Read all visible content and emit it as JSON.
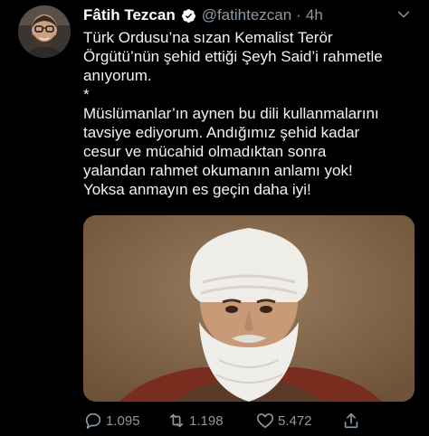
{
  "author": {
    "display_name": "Fâtih Tezcan",
    "handle": "@fatihtezcan",
    "separator": "·",
    "time": "4h",
    "avatar_icon": "avatar-photo"
  },
  "tweet": {
    "lines": [
      "Türk Ordusu’na sızan Kemalist Terör",
      "Örgütü’nün şehid ettiği Şeyh Said’i rahmetle",
      "anıyorum.",
      "*",
      "Müslümanlar’ın aynen bu dili kullanmalarını",
      "tavsiye ediyorum. Andığımız şehid kadar",
      "cesur ve mücahid olmadıktan sonra",
      "yalandan rahmet okumanın anlamı yok!",
      "Yoksa anmayın es geçin daha iyi!"
    ]
  },
  "media": {
    "alt_icon": "portrait-photo"
  },
  "actions": {
    "reply_count": "1.095",
    "retweet_count": "1.198",
    "like_count": "5.472"
  },
  "colors": {
    "background": "#000000",
    "text": "#ffffff",
    "muted": "#8b98a5",
    "verified": "#ffffff"
  }
}
